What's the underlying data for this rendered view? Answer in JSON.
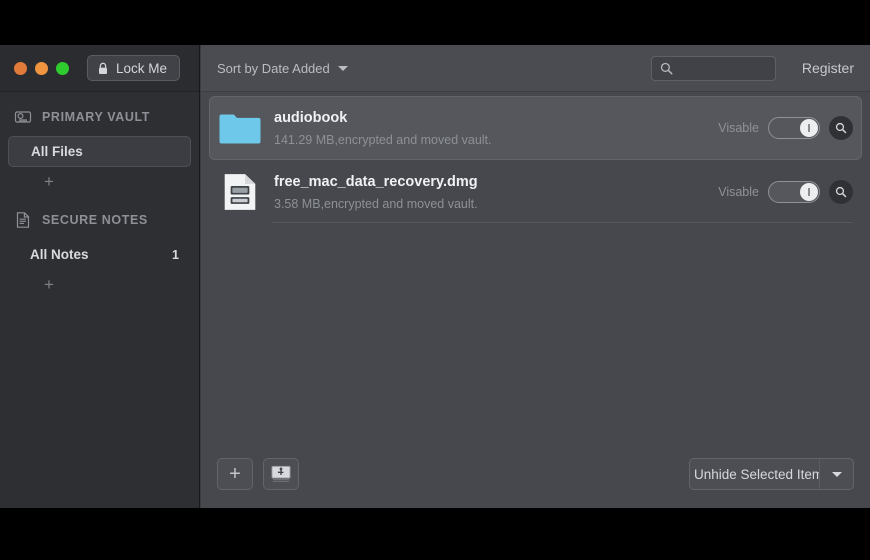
{
  "window": {
    "titlebar": {
      "traffic_lights": [
        {
          "name": "close",
          "color": "#e07b39"
        },
        {
          "name": "minimize",
          "color": "#ef9540"
        },
        {
          "name": "maximize",
          "color": "#2ecc2e"
        }
      ],
      "lock_button_label": "Lock Me"
    }
  },
  "sidebar": {
    "sections": [
      {
        "icon": "vault-drive-icon",
        "label": "PRIMARY VAULT",
        "items": [
          {
            "label": "All Files",
            "count": "",
            "selected": true
          }
        ],
        "add_label": "+"
      },
      {
        "icon": "note-document-icon",
        "label": "SECURE NOTES",
        "items": [
          {
            "label": "All Notes",
            "count": "1",
            "selected": false
          }
        ],
        "add_label": "+"
      }
    ]
  },
  "toolbar": {
    "sort_label": "Sort by Date Added",
    "sort_caret": "chevron-down-icon",
    "search": {
      "value": "",
      "placeholder": "",
      "icon": "search-icon"
    },
    "register_label": "Register"
  },
  "files": [
    {
      "icon": "folder-icon",
      "name": "audiobook",
      "subtitle": "141.29 MB,encrypted and moved vault.",
      "visibility_label": "Visable",
      "toggle_on": true,
      "magnifier_icon": "search-icon",
      "selected": true
    },
    {
      "icon": "dmg-disk-image-icon",
      "name": "free_mac_data_recovery.dmg",
      "subtitle": "3.58 MB,encrypted and moved vault.",
      "visibility_label": "Visable",
      "toggle_on": true,
      "magnifier_icon": "search-icon",
      "selected": false
    }
  ],
  "bottom_bar": {
    "add_button_label": "+",
    "import_button_icon": "usb-drive-icon",
    "action_select": {
      "value": "Unhide Selected Items",
      "caret": "chevron-down-icon"
    }
  },
  "colors": {
    "window_bg": "#3a3c40",
    "sidebar_bg": "#2e2f33",
    "main_bg": "#46484d",
    "toolbar_bg": "#4a4c51",
    "row_selected_bg": "#55575c",
    "folder_blue": "#6ec8ea",
    "accent_green": "#2ecc2e",
    "desktop_bg": "#000000"
  }
}
